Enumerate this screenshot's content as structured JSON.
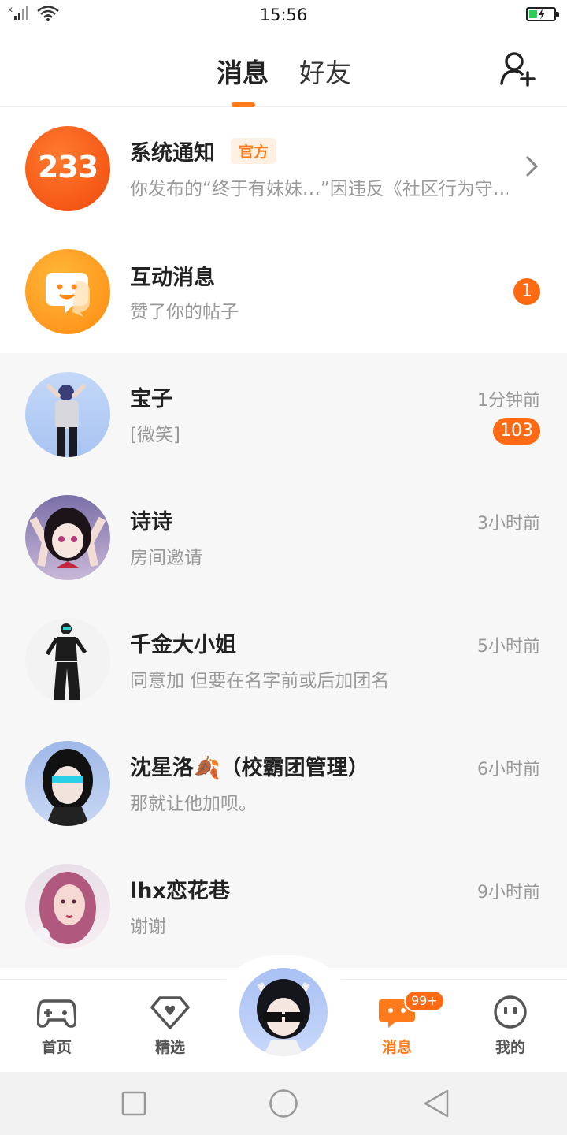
{
  "status_bar": {
    "time": "15:56"
  },
  "header": {
    "tabs": [
      {
        "label": "消息"
      },
      {
        "label": "好友"
      }
    ]
  },
  "official": [
    {
      "title": "系统通知",
      "tag": "官方",
      "subtitle": "你发布的“终于有妹妹…”因违反《社区行为守…",
      "avatar_text": "233"
    },
    {
      "title": "互动消息",
      "subtitle": "赞了你的帖子",
      "badge": "1"
    }
  ],
  "chats": [
    {
      "name": "宝子",
      "message": "[微笑]",
      "time": "1分钟前",
      "badge": "103"
    },
    {
      "name": "诗诗",
      "message": "房间邀请",
      "time": "3小时前"
    },
    {
      "name": "千金大小姐",
      "message": "同意加 但要在名字前或后加团名",
      "time": "5小时前"
    },
    {
      "name": "沈星洛🍂（校霸团管理）",
      "message": "那就让他加呗。",
      "time": "6小时前"
    },
    {
      "name": "lhx恋花巷",
      "message": "谢谢",
      "time": "9小时前"
    }
  ],
  "bottom_nav": [
    {
      "label": "首页",
      "icon": "gamepad-icon"
    },
    {
      "label": "精选",
      "icon": "heart-diamond-icon"
    },
    {
      "label": "消息",
      "icon": "chat-bubble-icon",
      "badge": "99+",
      "active": true
    },
    {
      "label": "我的",
      "icon": "face-icon"
    }
  ],
  "colors": {
    "accent": "#ff7a1a",
    "badge": "#ff6a13"
  }
}
